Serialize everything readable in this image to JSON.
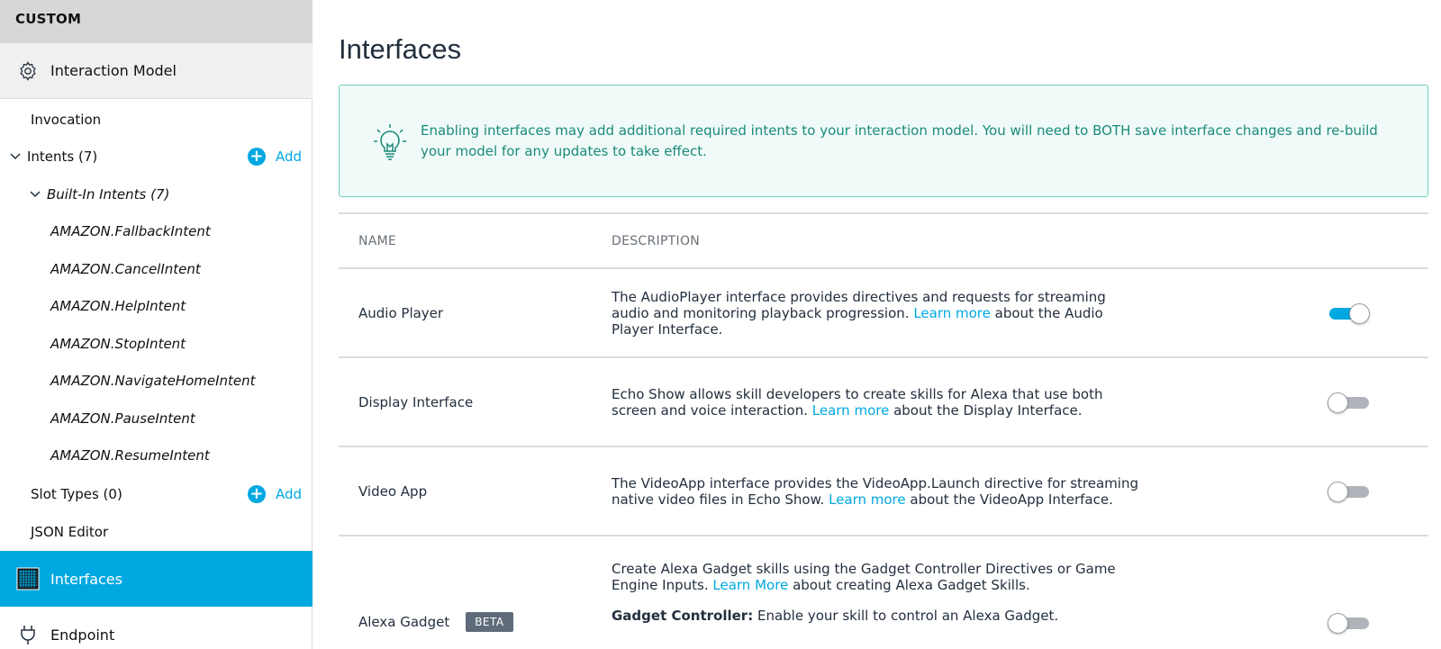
{
  "sidebar": {
    "header": "CUSTOM",
    "interaction_model": "Interaction Model",
    "invocation": "Invocation",
    "intents": "Intents (7)",
    "builtin": "Built-In Intents (7)",
    "intents_list": [
      "AMAZON.FallbackIntent",
      "AMAZON.CancelIntent",
      "AMAZON.HelpIntent",
      "AMAZON.StopIntent",
      "AMAZON.NavigateHomeIntent",
      "AMAZON.PauseIntent",
      "AMAZON.ResumeIntent"
    ],
    "slot_types": "Slot Types (0)",
    "json_editor": "JSON Editor",
    "add_label": "Add",
    "interfaces": "Interfaces",
    "endpoint": "Endpoint"
  },
  "main": {
    "title": "Interfaces",
    "info": "Enabling interfaces may add additional required intents to your interaction model. You will need to BOTH save interface changes and re-build your model for any updates to take effect.",
    "col_name": "NAME",
    "col_desc": "DESCRIPTION",
    "rows": [
      {
        "name": "Audio Player",
        "desc_pre": "The AudioPlayer interface provides directives and requests for streaming audio and monitoring playback progression.",
        "link": "Learn more",
        "desc_post": "about the Audio Player Interface.",
        "enabled": true
      },
      {
        "name": "Display Interface",
        "desc_pre": "Echo Show allows skill developers to create skills for Alexa that use both screen and voice interaction.",
        "link": "Learn more",
        "desc_post": "about the Display Interface.",
        "enabled": false
      },
      {
        "name": "Video App",
        "desc_pre": "The VideoApp interface provides the VideoApp.Launch directive for streaming native video files in Echo Show.",
        "link": "Learn more",
        "desc_post": "about the VideoApp Interface.",
        "enabled": false
      },
      {
        "name": "Alexa Gadget",
        "badge": "BETA",
        "desc_pre": "Create Alexa Gadget skills using the Gadget Controller Directives or Game Engine Inputs.",
        "link": "Learn More",
        "desc_post": "about creating Alexa Gadget Skills.",
        "sub_label": "Gadget Controller:",
        "sub_text": "Enable your skill to control an Alexa Gadget.",
        "enabled": false
      }
    ]
  },
  "colors": {
    "accent": "#00a8e1",
    "info_text": "#1b8a78",
    "info_border": "#6fd3bf"
  }
}
